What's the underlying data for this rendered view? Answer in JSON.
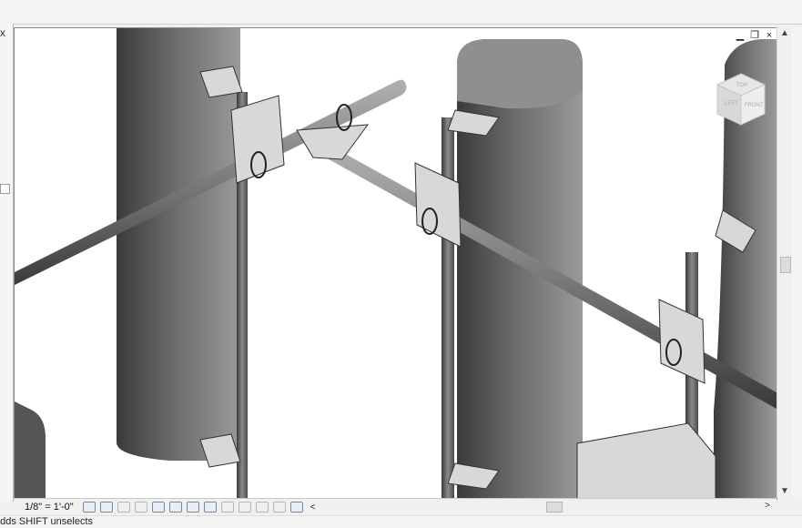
{
  "window": {
    "close_label": "×",
    "restore_label": "❐",
    "minimize_label": "▁"
  },
  "left_strip": {
    "close_glyph": "x"
  },
  "viewcube": {
    "face_right": "FRONT",
    "face_left": "LEFT",
    "face_top": "TOP"
  },
  "status": {
    "scale": "1/8\" = 1'-0\"",
    "scroll_left_arrow": "<",
    "scroll_right_arrow": ">"
  },
  "vscroll": {
    "up_arrow": "▲",
    "down_arrow": "▼"
  },
  "footer": {
    "text": "adds SHIFT unselects"
  },
  "icons": [
    "model-graphics-icon",
    "visual-style-icon",
    "sun-path-icon",
    "shadows-icon",
    "crop-view-icon",
    "show-crop-icon",
    "temporary-hide-icon",
    "reveal-hidden-icon",
    "worksharing-icon",
    "design-options-icon",
    "analytical-model-icon",
    "highlight-displacement-icon",
    "constraints-icon"
  ]
}
